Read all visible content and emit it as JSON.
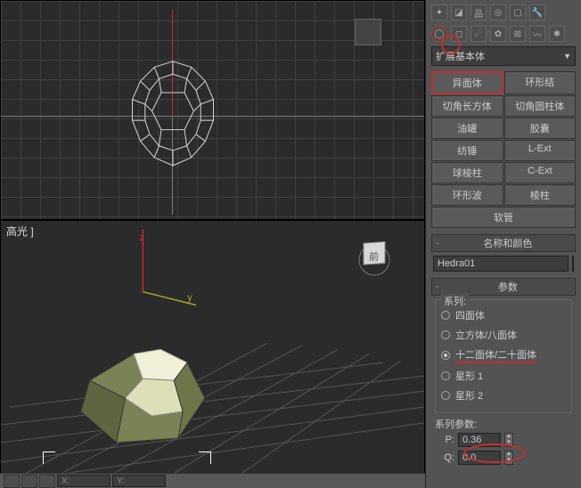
{
  "dropdown": {
    "label": "扩展基本体"
  },
  "objbuttons": [
    {
      "l": "异面体",
      "hl": true
    },
    {
      "l": "环形结"
    },
    {
      "l": "切角长方体"
    },
    {
      "l": "切角圆柱体"
    },
    {
      "l": "油罐"
    },
    {
      "l": "胶囊"
    },
    {
      "l": "纺锤"
    },
    {
      "l": "L-Ext"
    },
    {
      "l": "球棱柱"
    },
    {
      "l": "C-Ext"
    },
    {
      "l": "环形波"
    },
    {
      "l": "棱柱"
    },
    {
      "l": "软管",
      "wide": true
    }
  ],
  "rollouts": {
    "name": "名称和颜色",
    "params": "参数"
  },
  "objname": "Hedra01",
  "family": {
    "title": "系列:",
    "opts": [
      {
        "l": "四面体",
        "sel": false
      },
      {
        "l": "立方体/八面体",
        "sel": false
      },
      {
        "l": "十二面体/二十面体",
        "sel": true,
        "ul": true
      },
      {
        "l": "星形 1",
        "sel": false
      },
      {
        "l": "星形 2",
        "sel": false
      }
    ]
  },
  "fparams": {
    "title": "系列参数:",
    "p_lbl": "P:",
    "p": "0.36",
    "q_lbl": "Q:",
    "q": "0.0"
  },
  "vp": {
    "botlabel": "高光 ]"
  },
  "status": {
    "x": "X:",
    "y": "Y:"
  },
  "cube": "前"
}
